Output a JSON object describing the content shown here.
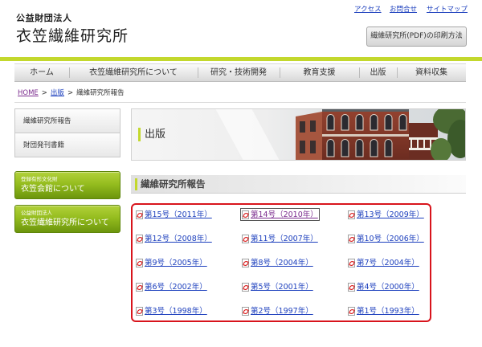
{
  "header": {
    "org_type": "公益財団法人",
    "org_name": "衣笠繊維研究所",
    "top_links": {
      "access": "アクセス",
      "contact": "お問合せ",
      "sitemap": "サイトマップ"
    },
    "print_button": "繊維研究所(PDF)の印刷方法"
  },
  "nav": {
    "items": [
      "ホーム",
      "衣笠繊維研究所について",
      "研究・技術開発",
      "教育支援",
      "出版",
      "資料収集"
    ]
  },
  "breadcrumb": {
    "home": "HOME",
    "separator": ">",
    "section": "出版",
    "current": "繊維研究所報告"
  },
  "sidebar": {
    "menu": [
      "繊維研究所報告",
      "財団発刊書籍"
    ],
    "banners": [
      {
        "caption": "登録有形文化財",
        "title": "衣笠会館について"
      },
      {
        "caption": "公益財団法人",
        "title": "衣笠繊維研究所について"
      }
    ]
  },
  "main": {
    "banner_title": "出版",
    "section_title": "繊維研究所報告",
    "reports": [
      "第15号（2011年）",
      "第14号（2010年）",
      "第13号（2009年）",
      "第12号（2008年）",
      "第11号（2007年）",
      "第10号（2006年）",
      "第9号（2005年）",
      "第8号（2004年）",
      "第7号（2004年）",
      "第6号（2002年）",
      "第5号（2001年）",
      "第4号（2000年）",
      "第3号（1998年）",
      "第2号（1997年）",
      "第1号（1993年）"
    ]
  },
  "icons": {
    "report_link": "pdf-icon"
  },
  "colors": {
    "accent": "#c3d82d",
    "link": "#1c3fbd",
    "visited_link": "#7b2b8e",
    "report_frame": "#d8141c",
    "banner_green_top": "#b2d13a",
    "banner_green_bottom": "#6c950d"
  }
}
